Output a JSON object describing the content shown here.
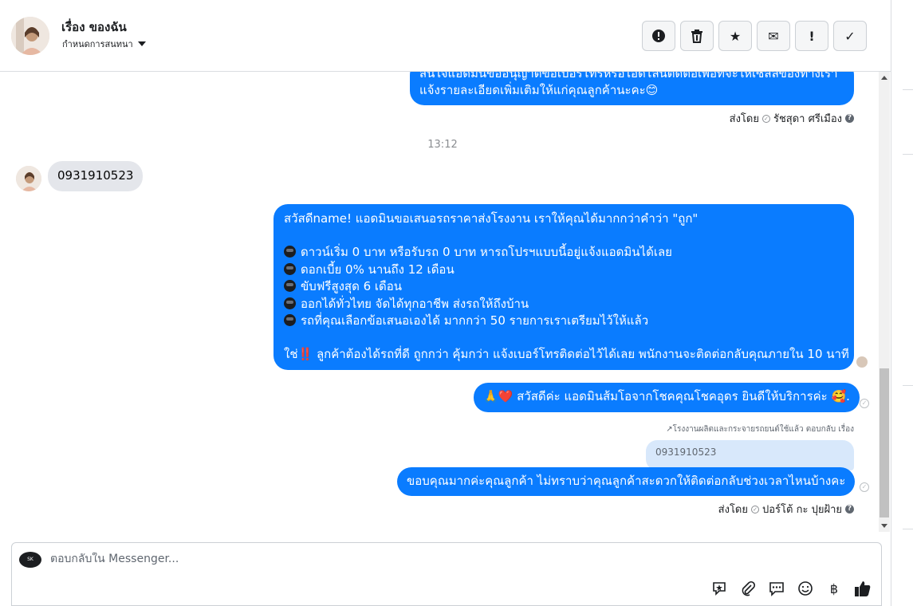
{
  "header": {
    "name": "เรื่อง ของฉัน",
    "subtitle": "กำหนดการสนทนา"
  },
  "actions": [
    {
      "icon": "exclamation-circle-icon",
      "glyph": "!"
    },
    {
      "icon": "trash-icon",
      "glyph": ""
    },
    {
      "icon": "star-icon",
      "glyph": "★"
    },
    {
      "icon": "envelope-icon",
      "glyph": "✉"
    },
    {
      "icon": "exclamation-icon",
      "glyph": "!"
    },
    {
      "icon": "checkmark-icon",
      "glyph": "✓"
    }
  ],
  "messages": {
    "first_out_lines": [
      "สนใจแอดมินขออนุญาตขอเบอร์โทรหรือไอดีไลน์ติดต่อเพื่อที่จะให้เซลล์ของทางเรา",
      "แจ้งรายละเอียดเพิ่มเติมให้แก่คุณลูกค้านะคะ😊"
    ],
    "first_meta": {
      "prefix": "ส่งโดย",
      "agent": "รัชสุดา ศรีเมือง"
    },
    "time": "13:12",
    "incoming": "0931910523",
    "promo_lines": [
      "สวัสดีname! แอดมินขอเสนอรถราคาส่งโรงงาน เราให้คุณได้มากกว่าคำว่า \"ถูก\"",
      "ดาวน์เริ่ม 0 บาท หรือรับรถ 0 บาท หารถโปรฯแบบนี้อยู่แจ้งแอดมินได้เลย",
      "ดอกเบี้ย 0% นานถึง 12 เดือน",
      "ขับฟรีสูงสุด 6 เดือน",
      "ออกได้ทั่วไทย จัดได้ทุกอาชีพ ส่งรถให้ถึงบ้าน",
      "รถที่คุณเลือกข้อเสนอเองได้ มากกว่า 50 รายการเราเตรียมไว้ให้แล้ว",
      "ใช่‼️ ลูกค้าต้องได้รถที่ดี ถูกกว่า คุ้มกว่า แจ้งเบอร์โทรติดต่อไว้ได้เลย พนักงานจะติดต่อกลับคุณภายใน 10 นาที"
    ],
    "greeting": "🙏❤️ สวัสดีค่ะ แอดมินส้มโอจากโชคคุณโชคอุดร ยินดีให้บริการค่ะ 🥰.",
    "reply_note": "↗โรงงานผลิตและกระจายรถยนต์ใช้แล้ว ตอบกลับ เรื่อง",
    "quoted": "0931910523",
    "thanks": "ขอบคุณมากค่ะคุณลูกค้า ไม่ทราบว่าคุณลูกค้าสะดวกให้ติดต่อกลับช่วงเวลาไหนบ้างคะ",
    "last_meta": {
      "prefix": "ส่งโดย",
      "agent": "ปอร์โต้ กะ ปุยฝ้าย"
    }
  },
  "composer": {
    "placeholder": "ตอบกลับใน Messenger...",
    "logo_text": "SK",
    "tools": [
      "sticker-icon",
      "attachment-icon",
      "chat-bubbles-icon",
      "emoji-icon",
      "baht-icon",
      "like-icon"
    ]
  }
}
